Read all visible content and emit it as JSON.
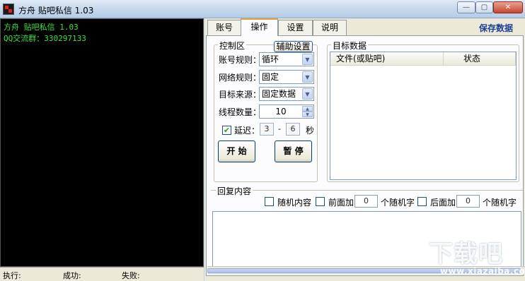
{
  "window": {
    "title": "方舟 贴吧私信 1.03",
    "controls": {
      "minimize": "—",
      "maximize": "▢",
      "close": "✕"
    }
  },
  "console": {
    "lines": [
      "方舟 贴吧私信 1.03",
      "QQ交流群：330297133"
    ]
  },
  "status_bar": {
    "executing_label": "执行:",
    "success_label": "成功:",
    "fail_label": "失败:"
  },
  "tabs": [
    {
      "label": "账号",
      "active": false
    },
    {
      "label": "操作",
      "active": true
    },
    {
      "label": "设置",
      "active": false
    },
    {
      "label": "说明",
      "active": false
    }
  ],
  "save_data_label": "保存数据",
  "control_area": {
    "title": "控制区",
    "aux_button": "辅助设置",
    "account_rule": {
      "label": "账号规则：",
      "value": "循环"
    },
    "network_rule": {
      "label": "网络规则：",
      "value": "固定"
    },
    "target_source": {
      "label": "目标来源：",
      "value": "固定数据"
    },
    "thread_count": {
      "label": "线程数量：",
      "value": "10"
    },
    "delay": {
      "checked": true,
      "label": "延迟：",
      "min": "3",
      "separator": "-",
      "max": "6",
      "unit": "秒"
    },
    "start_button": "开 始",
    "pause_button": "暂 停"
  },
  "target_data": {
    "title": "目标数据",
    "columns": [
      "文件(或贴吧)",
      "状态"
    ]
  },
  "reply_content": {
    "title": "回复内容",
    "random_content": {
      "checked": false,
      "label": "随机内容"
    },
    "prefix": {
      "checked": false,
      "label": "前面加",
      "value": "0",
      "suffix": "个随机字"
    },
    "postfix": {
      "checked": false,
      "label": "后面加",
      "value": "0",
      "suffix": "个随机字"
    }
  },
  "watermark": {
    "text": "下载吧",
    "url": "www.xiazaiba.com"
  },
  "colors": {
    "console_text": "#3ee03e",
    "save_data": "#1c3f95",
    "active_tab_accent": "#e8a33a"
  }
}
